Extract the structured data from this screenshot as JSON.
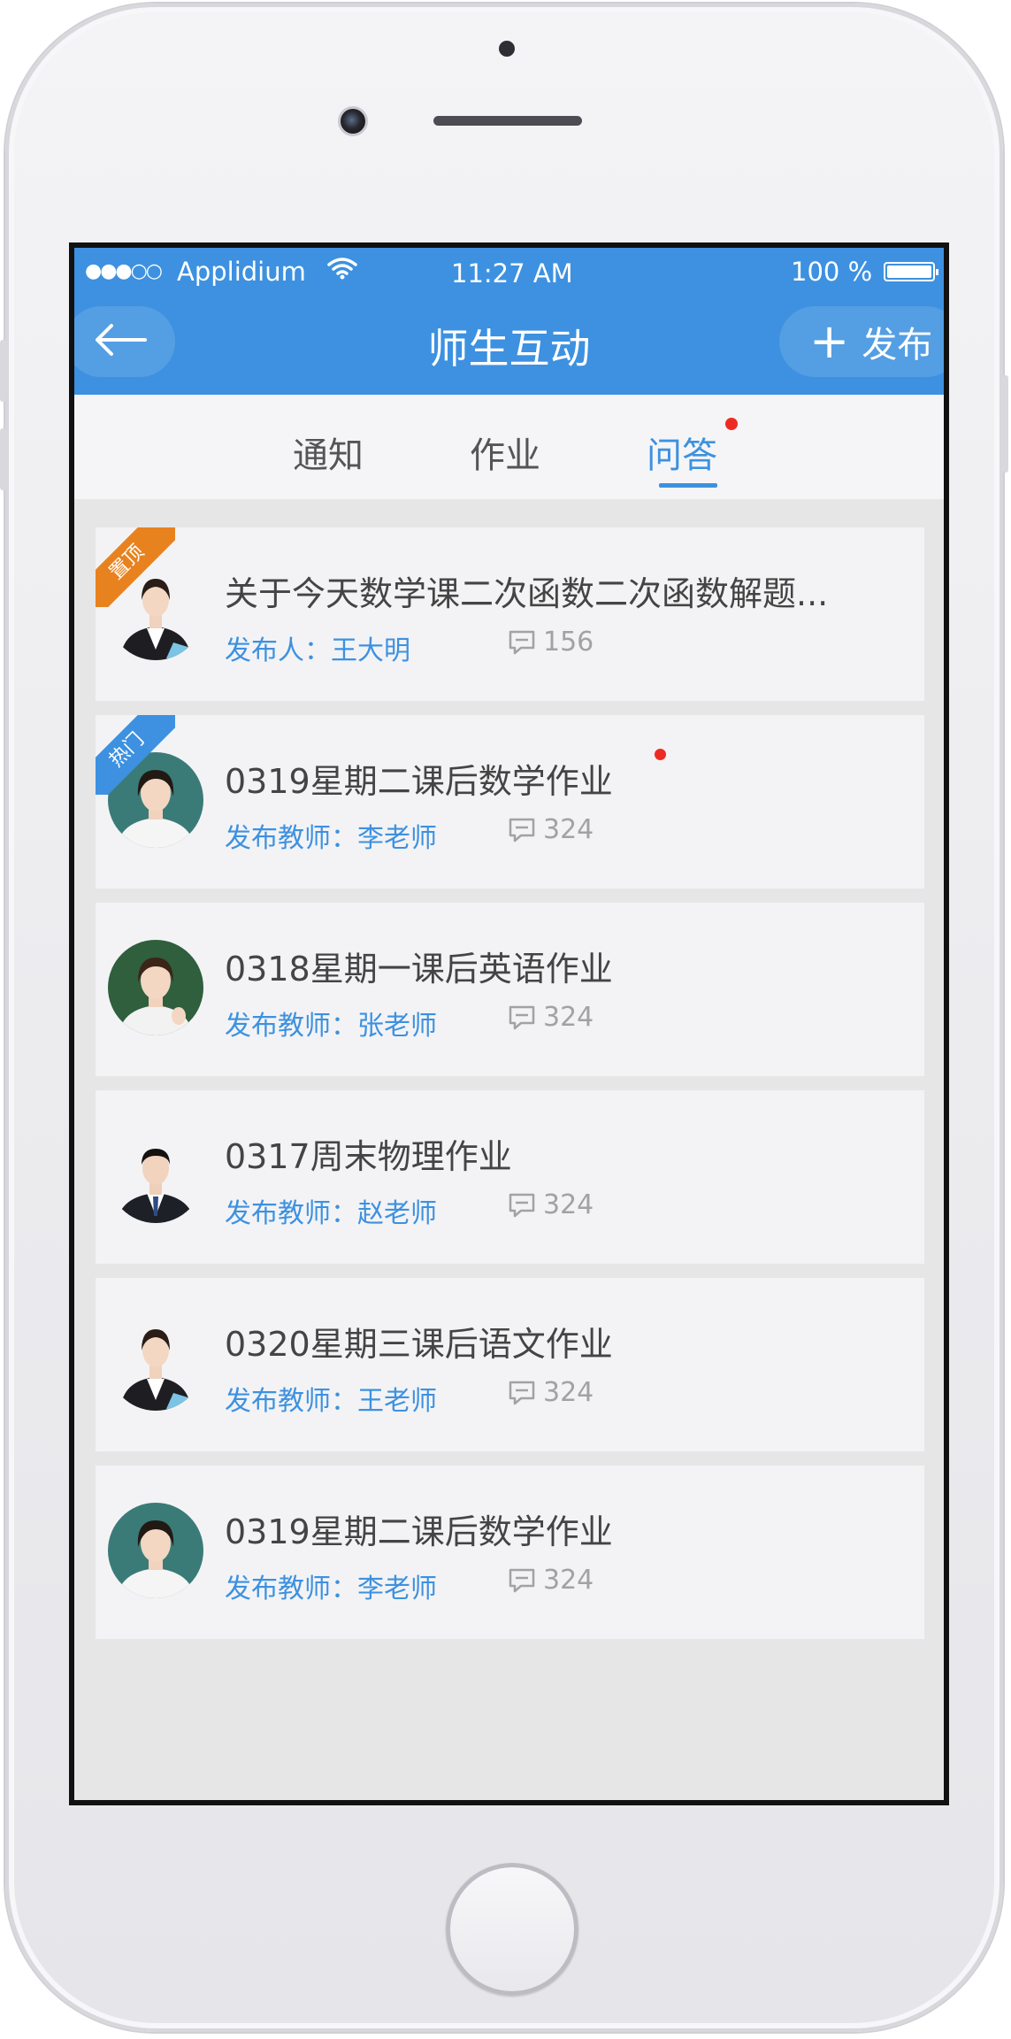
{
  "status_bar": {
    "signal": "●●●○○",
    "carrier": "Applidium",
    "time": "11:27 AM",
    "battery": "100 %"
  },
  "nav": {
    "title": "师生互动",
    "publish_label": "发布"
  },
  "tabs": [
    {
      "label": "通知",
      "active": false
    },
    {
      "label": "作业",
      "active": false
    },
    {
      "label": "问答",
      "active": true,
      "has_dot": true
    }
  ],
  "items": [
    {
      "badge": "置顶",
      "badge_color": "#e8821f",
      "title": "关于今天数学课二次函数二次函数解题...",
      "author": "发布人：王大明",
      "comments": "156",
      "unread": false
    },
    {
      "badge": "热门",
      "badge_color": "#3d91e0",
      "title": "0319星期二课后数学作业",
      "author": "发布教师：李老师",
      "comments": "324",
      "unread": true
    },
    {
      "badge": "",
      "title": "0318星期一课后英语作业",
      "author": "发布教师：张老师",
      "comments": "324",
      "unread": false
    },
    {
      "badge": "",
      "title": "0317周末物理作业",
      "author": "发布教师：赵老师",
      "comments": "324",
      "unread": false
    },
    {
      "badge": "",
      "title": "0320星期三课后语文作业",
      "author": "发布教师：王老师",
      "comments": "324",
      "unread": false
    },
    {
      "badge": "",
      "title": "0319星期二课后数学作业",
      "author": "发布教师：李老师",
      "comments": "324",
      "unread": false
    }
  ],
  "colors": {
    "accent": "#3d91e0",
    "pinned_badge": "#e8821f",
    "unread_dot": "#ee2b22"
  }
}
